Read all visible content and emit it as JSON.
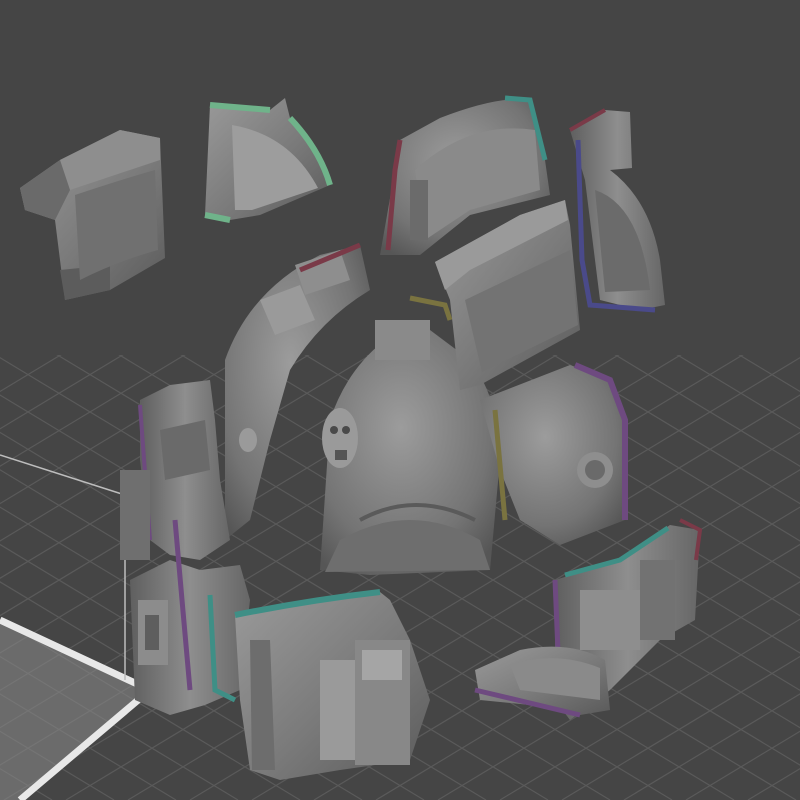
{
  "viewport": {
    "background_color": "#454545",
    "grid_color": "#5a5a5a",
    "grid_accent_color": "#6a6a6a",
    "build_plate_color": "#8a8a8a",
    "build_plate_border_color": "#e8e8e8"
  },
  "model": {
    "piece_fill": "#7d7d7d",
    "piece_shade": "#5e5e5e",
    "piece_highlight": "#a5a5a5",
    "edge_colors": {
      "green": "#6fb38a",
      "teal": "#3f8f86",
      "purple": "#6e4a80",
      "maroon": "#7a3a48",
      "olive": "#7a7340",
      "navy": "#4a4a8a"
    }
  }
}
